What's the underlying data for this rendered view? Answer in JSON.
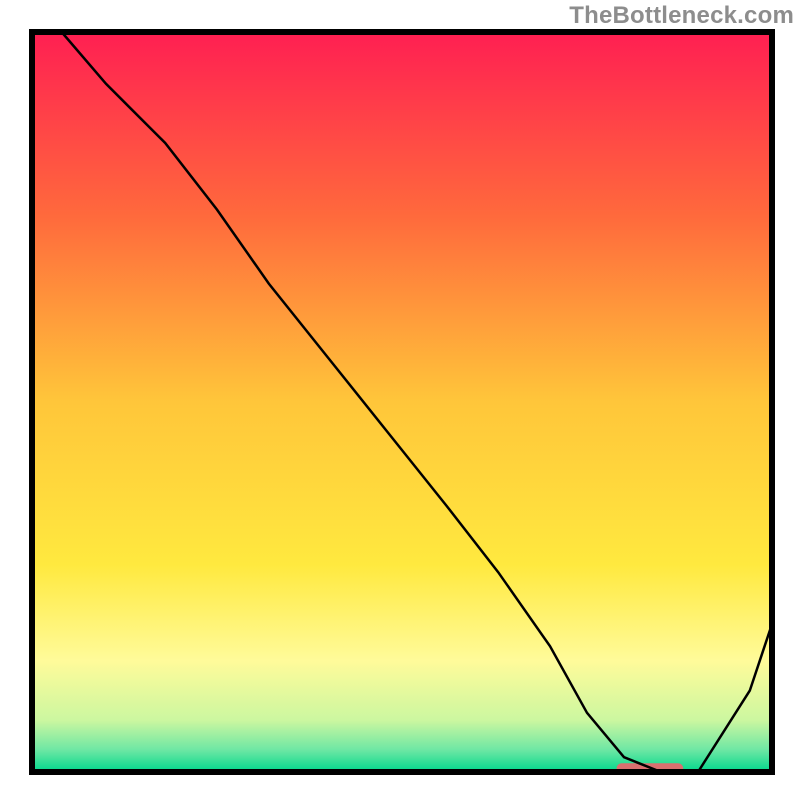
{
  "watermark": "TheBottleneck.com",
  "chart_data": {
    "type": "line",
    "title": "",
    "xlabel": "",
    "ylabel": "",
    "xlim": [
      0,
      100
    ],
    "ylim": [
      0,
      100
    ],
    "x": [
      4,
      10,
      18,
      25,
      32,
      40,
      48,
      56,
      63,
      70,
      75,
      80,
      85,
      90,
      97,
      100
    ],
    "values": [
      100,
      93,
      85,
      76,
      66,
      56,
      46,
      36,
      27,
      17,
      8,
      2,
      0,
      0,
      11,
      20
    ],
    "background_gradient": {
      "stops": [
        {
          "pos": 0.0,
          "color": "#ff1f52"
        },
        {
          "pos": 0.25,
          "color": "#ff6a3c"
        },
        {
          "pos": 0.5,
          "color": "#ffc63a"
        },
        {
          "pos": 0.72,
          "color": "#ffe93f"
        },
        {
          "pos": 0.85,
          "color": "#fffb9a"
        },
        {
          "pos": 0.93,
          "color": "#ccf7a0"
        },
        {
          "pos": 0.97,
          "color": "#6ee7a4"
        },
        {
          "pos": 1.0,
          "color": "#00d88c"
        }
      ]
    },
    "marker": {
      "x_range": [
        79,
        88
      ],
      "y": 0.5,
      "color": "#d96f6f"
    },
    "frame_color": "#000000"
  }
}
